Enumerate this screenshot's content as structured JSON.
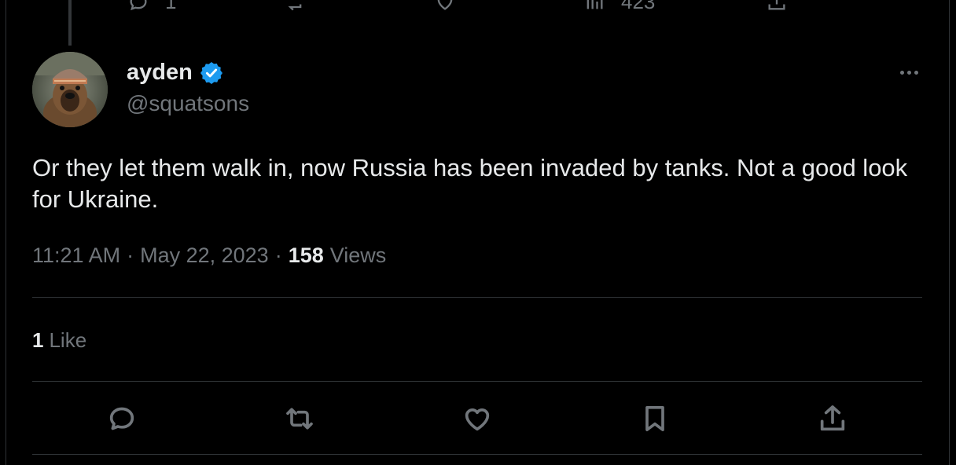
{
  "parent_tweet": {
    "reply_count": "1",
    "views_count": "423"
  },
  "author": {
    "display_name": "ayden",
    "handle": "@squatsons",
    "verified": true,
    "avatar_icon": "dog-wearing-beanie-avatar"
  },
  "tweet": {
    "text": "Or they let them walk in, now Russia has been invaded by tanks. Not a good look for Ukraine.",
    "time": "11:21 AM",
    "date": "May 22, 2023",
    "views_count": "158",
    "views_label": "Views",
    "separator": "·"
  },
  "engagement": {
    "like_count": "1",
    "like_label": "Like"
  },
  "actions": [
    {
      "name": "reply",
      "icon": "reply-icon"
    },
    {
      "name": "retweet",
      "icon": "retweet-icon"
    },
    {
      "name": "like",
      "icon": "heart-icon"
    },
    {
      "name": "bookmark",
      "icon": "bookmark-icon"
    },
    {
      "name": "share",
      "icon": "share-icon"
    }
  ],
  "colors": {
    "background": "#000000",
    "primary_text": "#e7e9ea",
    "secondary_text": "#71767b",
    "divider": "#2f3336",
    "verified_badge": "#1d9bf0"
  }
}
